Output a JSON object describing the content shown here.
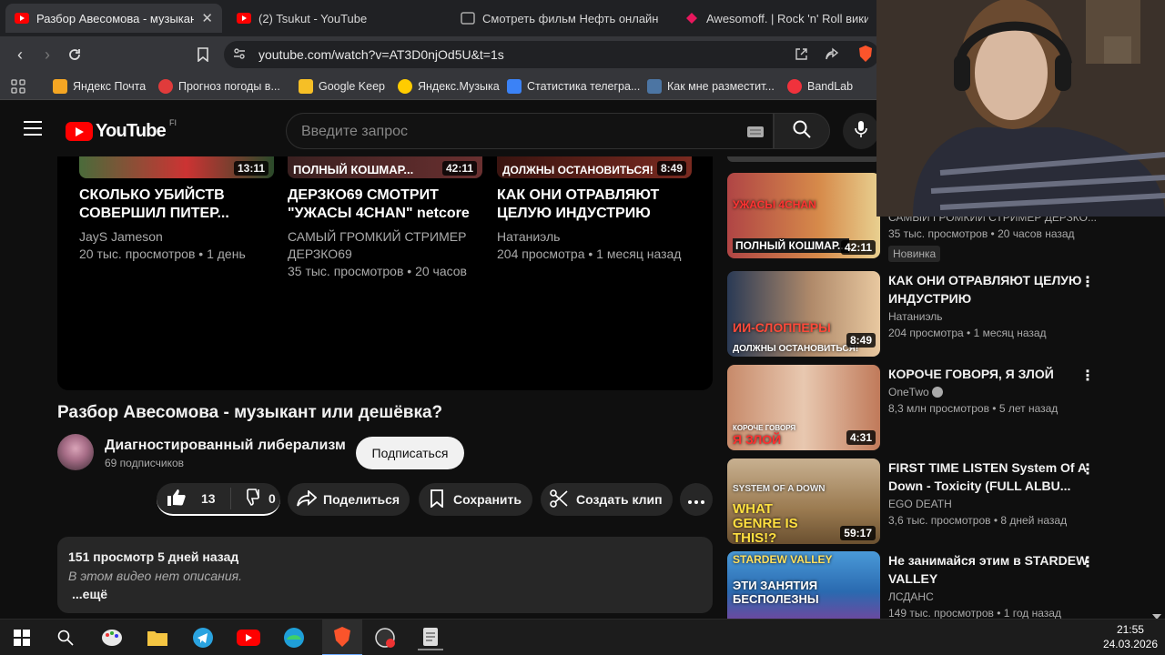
{
  "browser": {
    "tabs": [
      {
        "title": "Разбор Авесомова - музыкант и дешёвка?",
        "close": "✕"
      },
      {
        "title": "(2) Tsukut - YouTube"
      },
      {
        "title": "Смотреть фильм Нефть онлайн бесплатно"
      },
      {
        "title": "Awesomoff. | Rock 'n' Roll вики | Fa"
      }
    ],
    "url": "youtube.com/watch?v=AT3D0njOd5U&t=1s",
    "bookmarks": [
      {
        "label": "Яндекс Почта",
        "color": "#f5a623"
      },
      {
        "label": "Прогноз погоды в...",
        "color": "#e03b3b"
      },
      {
        "label": "Google Keep",
        "color": "#f6bf26"
      },
      {
        "label": "Яндекс.Музыка",
        "color": "#ffcc00"
      },
      {
        "label": "Статистика телегра...",
        "color": "#3b82f6"
      },
      {
        "label": "Как мне разместит...",
        "color": "#4c75a3"
      },
      {
        "label": "BandLab",
        "color": "#f0323c"
      }
    ]
  },
  "youtube": {
    "logo_text": "YouTube",
    "logo_region": "FI",
    "search_placeholder": "Введите запрос",
    "endcards": [
      {
        "thumb_text": "",
        "duration": "13:11",
        "title": "СКОЛЬКО УБИЙСТВ СОВЕРШИЛ ПИТЕР...",
        "channel": "JayS Jameson",
        "meta": "20 тыс. просмотров • 1 день"
      },
      {
        "thumb_text": "ПОЛНЫЙ КОШМАР...",
        "duration": "42:11",
        "title": "ДЕРЗКО69 СМОТРИТ \"УЖАСЫ 4CHAN\" netcore",
        "channel": "САМЫЙ ГРОМКИЙ СТРИМЕР ДЕРЗКО69",
        "meta": "35 тыс. просмотров • 20 часов"
      },
      {
        "thumb_text": "ДОЛЖНЫ ОСТАНОВИТЬСЯ!",
        "duration": "8:49",
        "title": "КАК ОНИ ОТРАВЛЯЮТ ЦЕЛУЮ ИНДУСТРИЮ",
        "channel": "Натаниэль",
        "meta": "204 просмотра • 1 месяц назад"
      }
    ],
    "video_title": "Разбор Авесомова - музыкант или дешёвка?",
    "channel_name": "Диагностированный либерализм",
    "subscribers": "69 подписчиков",
    "subscribe_label": "Подписаться",
    "likes": "13",
    "dislikes": "0",
    "share_label": "Поделиться",
    "save_label": "Сохранить",
    "clip_label": "Создать клип",
    "description": {
      "stats": "151 просмотр  5 дней назад",
      "text": "В этом видео нет описания.",
      "more": "...ещё"
    },
    "sidebar": [
      {
        "thumb_text": "ПОЛНЫЙ КОШМАР...",
        "thumb_text2": "УЖАСЫ 4CHAN",
        "duration": "42:11",
        "title": "",
        "channel": "САМЫЙ ГРОМКИЙ СТРИМЕР ДЕРЗКО...",
        "views": "35 тыс. просмотров • 20 часов назад",
        "badge": "Новинка"
      },
      {
        "thumb_text": "ИИ-СЛОППЕРЫ",
        "thumb_text2": "ДОЛЖНЫ ОСТАНОВИТЬСЯ!",
        "duration": "8:49",
        "title": "КАК ОНИ ОТРАВЛЯЮТ ЦЕЛУЮ ИНДУСТРИЮ",
        "channel": "Натаниэль",
        "views": "204 просмотра • 1 месяц назад"
      },
      {
        "thumb_text": "Я ЗЛОЙ",
        "thumb_text2": "КОРОЧЕ ГОВОРЯ",
        "duration": "4:31",
        "title": "КОРОЧЕ ГОВОРЯ, Я ЗЛОЙ",
        "channel": "OneTwo",
        "views": "8,3 млн просмотров • 5 лет назад"
      },
      {
        "thumb_text": "WHAT GENRE IS THIS!?",
        "thumb_text2": "SYSTEM OF A DOWN",
        "duration": "59:17",
        "title": "FIRST TIME LISTEN System Of A Down - Toxicity (FULL ALBU...",
        "channel": "EGO DEATH",
        "views": "3,6 тыс. просмотров • 8 дней назад"
      },
      {
        "thumb_text": "ЭТИ ЗАНЯТИЯ БЕСПОЛЕЗНЫ",
        "thumb_text2": "STARDEW VALLEY",
        "duration": "",
        "title": "Не занимайся  этим в STARDEW VALLEY",
        "channel": "ЛСДАНС",
        "views": "149 тыс. просмотров • 1 год назад"
      }
    ]
  },
  "taskbar": {
    "time": "21:55",
    "date": "24.03.2026"
  },
  "colors": {
    "youtube_red": "#ff0000",
    "bg": "#0f0f0f",
    "chip": "#272727"
  }
}
